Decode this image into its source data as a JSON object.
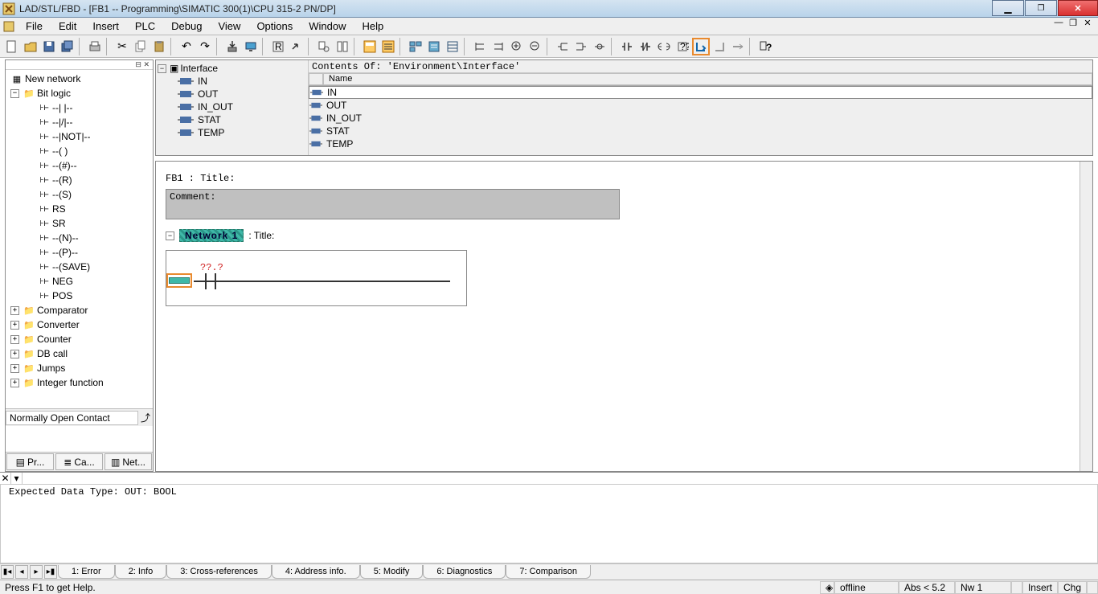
{
  "title": "LAD/STL/FBD  - [FB1 -- Programming\\SIMATIC 300(1)\\CPU 315-2 PN/DP]",
  "menu": [
    "File",
    "Edit",
    "Insert",
    "PLC",
    "Debug",
    "View",
    "Options",
    "Window",
    "Help"
  ],
  "left": {
    "new_network": "New network",
    "bit_logic": "Bit logic",
    "bit_items": [
      "--| |--",
      "--|/|--",
      "--|NOT|--",
      "--( )",
      "--(#)--",
      "--(R)",
      "--(S)",
      "RS",
      "SR",
      "--(N)--",
      "--(P)--",
      "--(SAVE)",
      "NEG",
      "POS"
    ],
    "folders": [
      "Comparator",
      "Converter",
      "Counter",
      "DB call",
      "Jumps",
      "Integer function"
    ],
    "hint": "Normally Open Contact",
    "tabs": [
      "Pr...",
      "Ca...",
      "Net..."
    ]
  },
  "iface": {
    "path": "Contents Of: 'Environment\\Interface'",
    "root": "Interface",
    "items": [
      "IN",
      "OUT",
      "IN_OUT",
      "STAT",
      "TEMP"
    ],
    "col": "Name"
  },
  "net": {
    "fb": "FB1 : Title:",
    "comment": "Comment:",
    "network": "Network 1",
    "nettail": ": Title:",
    "unknown": "??.?"
  },
  "msg": {
    "text": "Expected Data Type: OUT: BOOL",
    "tabs": [
      "1: Error",
      "2: Info",
      "3: Cross-references",
      "4: Address info.",
      "5: Modify",
      "6: Diagnostics",
      "7: Comparison"
    ]
  },
  "status": {
    "help": "Press F1 to get Help.",
    "mode": "offline",
    "abs": "Abs < 5.2",
    "nw": "Nw 1",
    "ins": "Insert",
    "chg": "Chg"
  }
}
